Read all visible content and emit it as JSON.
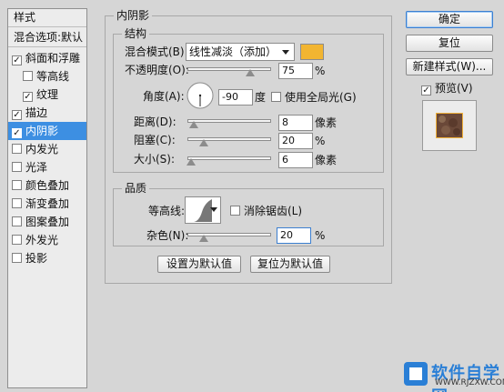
{
  "style_list": {
    "header": "样式",
    "blend_options": "混合选项:默认",
    "items": [
      {
        "label": "斜面和浮雕",
        "checked": true,
        "indent": false,
        "selected": false
      },
      {
        "label": "等高线",
        "checked": false,
        "indent": true,
        "selected": false
      },
      {
        "label": "纹理",
        "checked": true,
        "indent": true,
        "selected": false
      },
      {
        "label": "描边",
        "checked": true,
        "indent": false,
        "selected": false
      },
      {
        "label": "内阴影",
        "checked": true,
        "indent": false,
        "selected": true
      },
      {
        "label": "内发光",
        "checked": false,
        "indent": false,
        "selected": false
      },
      {
        "label": "光泽",
        "checked": false,
        "indent": false,
        "selected": false
      },
      {
        "label": "颜色叠加",
        "checked": false,
        "indent": false,
        "selected": false
      },
      {
        "label": "渐变叠加",
        "checked": false,
        "indent": false,
        "selected": false
      },
      {
        "label": "图案叠加",
        "checked": false,
        "indent": false,
        "selected": false
      },
      {
        "label": "外发光",
        "checked": false,
        "indent": false,
        "selected": false
      },
      {
        "label": "投影",
        "checked": false,
        "indent": false,
        "selected": false
      }
    ]
  },
  "panel": {
    "title": "内阴影",
    "structure": {
      "title": "结构",
      "blend_mode_label": "混合模式(B):",
      "blend_mode_value": "线性减淡（添加）",
      "shadow_color": "#f2b531",
      "opacity_label": "不透明度(O):",
      "opacity_value": "75",
      "opacity_unit": "%",
      "opacity_level": 0.75,
      "angle_label": "角度(A):",
      "angle_value": "-90",
      "angle_unit": "度",
      "global_light_label": "使用全局光(G)",
      "global_light_checked": false,
      "distance_label": "距离(D):",
      "distance_value": "8",
      "distance_unit": "像素",
      "distance_level": 0.08,
      "choke_label": "阻塞(C):",
      "choke_value": "20",
      "choke_unit": "%",
      "choke_level": 0.2,
      "size_label": "大小(S):",
      "size_value": "6",
      "size_unit": "像素",
      "size_level": 0.04
    },
    "quality": {
      "title": "品质",
      "contour_label": "等高线:",
      "antialias_label": "消除锯齿(L)",
      "antialias_checked": false,
      "noise_label": "杂色(N):",
      "noise_value": "20",
      "noise_unit": "%",
      "noise_level": 0.2
    },
    "make_default": "设置为默认值",
    "reset_default": "复位为默认值"
  },
  "buttons": {
    "ok": "确定",
    "reset": "复位",
    "new_style": "新建样式(W)...",
    "preview_label": "预览(V)",
    "preview_checked": true
  },
  "watermark": {
    "text": "软件自学网",
    "url": "WWW.RJZXW.COM"
  }
}
